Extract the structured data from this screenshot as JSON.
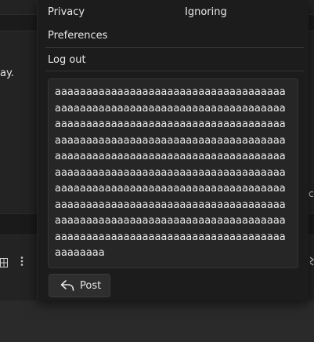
{
  "background": {
    "left_text": "ay.",
    "right_glyph": "c"
  },
  "menu": {
    "privacy_label": "Privacy",
    "ignoring_label": "Ignoring",
    "preferences_label": "Preferences",
    "logout_label": "Log out"
  },
  "composer": {
    "text": "aaaaaaaaaaaaaaaaaaaaaaaaaaaaaaaaaaaaaaaaaaaaaaaaaaaaaaaaaaaaaaaaaaaaaaaaaaaaaaaaaaaaaaaaaaaaaaaaaaaaaaaaaaaaaaaaaaaaaaaaaaaaaaaaaaaaaaaaaaaaaaaaaaaaaaaaaaaaaaaaaaaaaaaaaaaaaaaaaaaaaaaaaaaaaaaaaaaaaaaaaaaaaaaaaaaaaaaaaaaaaaaaaaaaaaaaaaaaaaaaaaaaaaaaaaaaaaaaaaaaaaaaaaaaaaaaaaaaaaaaaaaaaaaaaaaaaaaaaaaaaaaaaaaaaaaaaaaaaaaaaaaaaaaaaaaaaaaaaaaaaaaaaaaaaaaaaaaaaaaaaaaaaaaaaaaaaaaaaa",
    "post_label": "Post",
    "post_icon": "reply-arrow-icon"
  },
  "icons": {
    "grid": "grid-icon",
    "kebab": "kebab-menu-icon"
  }
}
